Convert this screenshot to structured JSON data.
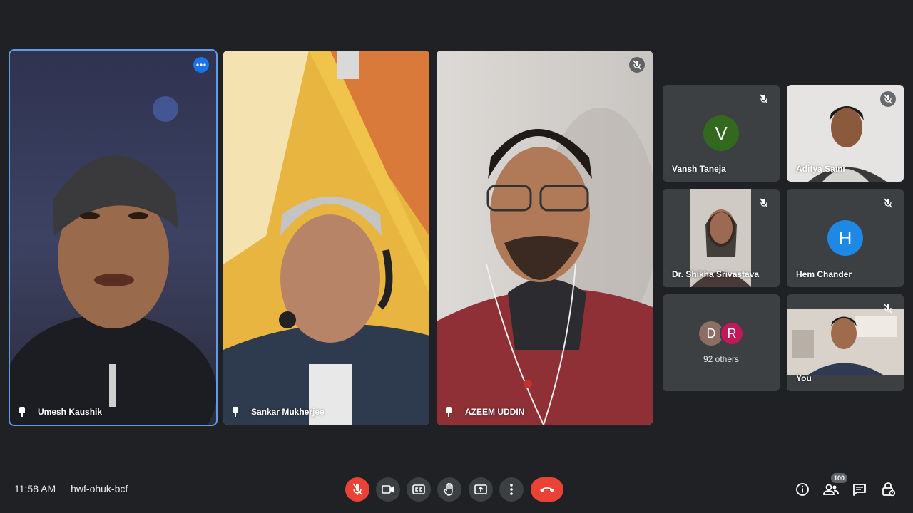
{
  "participants_main": [
    {
      "name": "Umesh Kaushik",
      "pinned": true
    },
    {
      "name": "Sankar Mukherjee",
      "pinned": true
    },
    {
      "name": "AZEEM UDDIN",
      "pinned": true
    }
  ],
  "participants_side": [
    {
      "name": "Vansh Taneja",
      "initial": "V",
      "avatar_color": "#33691e"
    },
    {
      "name": "Aditya Saini"
    },
    {
      "name": "Dr. Shikha Srivastava"
    },
    {
      "name": "Hem Chander",
      "initial": "H",
      "avatar_color": "#1e88e5"
    },
    {
      "others_label": "92 others",
      "initials": [
        "D",
        "R"
      ],
      "colors": [
        "#8d6e63",
        "#c2185b"
      ]
    },
    {
      "name": "You"
    }
  ],
  "meeting": {
    "time": "11:58 AM",
    "code": "hwf-ohuk-bcf"
  },
  "people_count": "100",
  "colors": {
    "background": "#202124",
    "control": "#3c4043",
    "danger": "#ea4335",
    "accent": "#1a73e8"
  }
}
